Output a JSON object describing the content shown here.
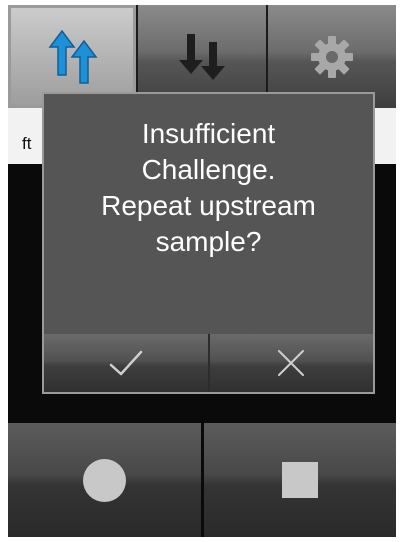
{
  "tabs": [
    {
      "icon": "upstream-arrows-icon",
      "active": true
    },
    {
      "icon": "downstream-arrows-icon",
      "active": false
    },
    {
      "icon": "gear-icon",
      "active": false
    }
  ],
  "strip": {
    "label": "ft"
  },
  "dialog": {
    "message_lines": [
      "Insufficient",
      "Challenge.",
      "Repeat upstream",
      "sample?"
    ],
    "confirm_icon": "checkmark-icon",
    "cancel_icon": "close-icon"
  },
  "controls": {
    "record_icon": "record-circle-icon",
    "stop_icon": "stop-square-icon"
  },
  "colors": {
    "accent_blue": "#1e90d8",
    "icon_dark": "#1e1e1e",
    "icon_light": "#c8c8c8",
    "dialog_bg": "#555555"
  }
}
